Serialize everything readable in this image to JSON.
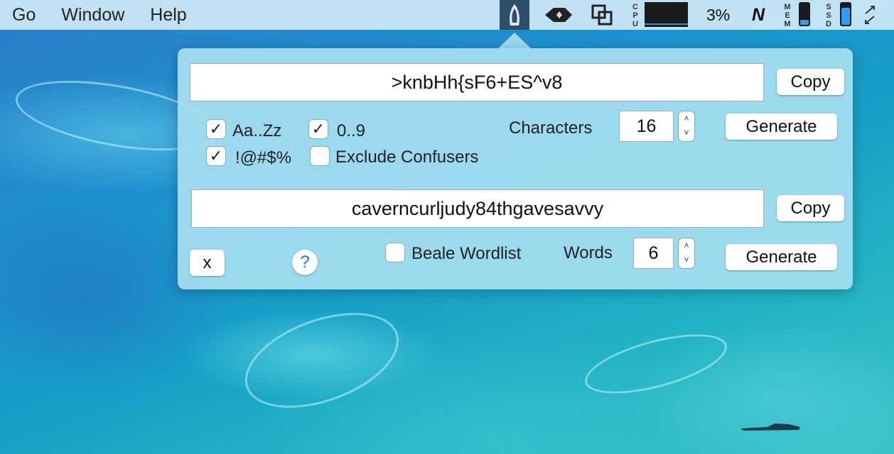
{
  "menubar": {
    "items": [
      "Go",
      "Window",
      "Help"
    ],
    "tray": {
      "cpu_label": "CPU",
      "cpu_percent": "3%",
      "n_label": "N",
      "mem_label": "MEM",
      "ssd_label": "SSD",
      "mem_level": 0.25,
      "ssd_level": 0.8
    }
  },
  "popover": {
    "password_value": ">knbHh{sF6+ES^v8",
    "copy_label": "Copy",
    "options": {
      "letters_label": "Aa..Zz",
      "letters_checked": true,
      "digits_label": "0..9",
      "digits_checked": true,
      "symbols_label": "!@#$%",
      "symbols_checked": true,
      "exclude_label": "Exclude Confusers",
      "exclude_checked": false
    },
    "characters_label": "Characters",
    "characters_value": "16",
    "generate_label": "Generate",
    "passphrase_value": "caverncurljudy84thgavesavvy",
    "close_label": "x",
    "help_label": "?",
    "beale_label": "Beale Wordlist",
    "beale_checked": false,
    "words_label": "Words",
    "words_value": "6"
  },
  "colors": {
    "accent": "#1a7ce6",
    "meter_fill": "#2f9df2"
  }
}
